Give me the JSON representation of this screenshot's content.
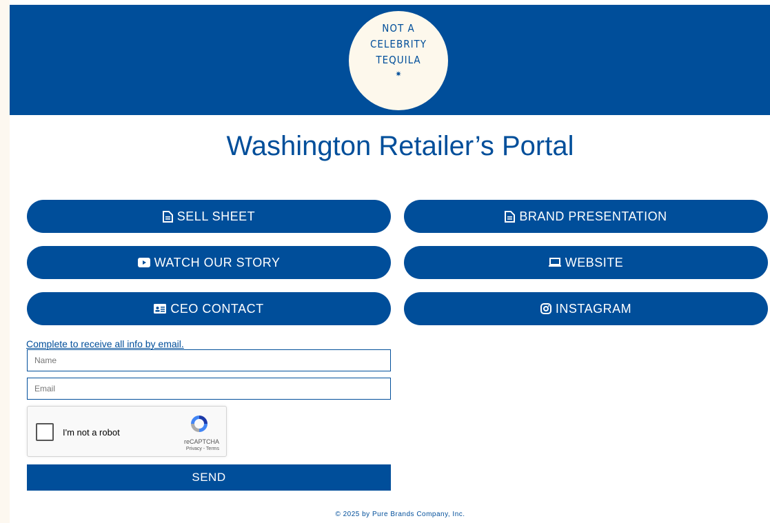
{
  "brand": {
    "logo_lines": [
      "NOT A",
      "CELEBRITY",
      "TEQUILA"
    ],
    "logo_mark_icon": "agave-icon"
  },
  "page": {
    "title": "Washington Retailer’s Portal"
  },
  "buttons": {
    "sell_sheet": {
      "label": "SELL SHEET",
      "icon": "document-icon"
    },
    "brand_presentation": {
      "label": "BRAND PRESENTATION",
      "icon": "document-icon"
    },
    "watch_story": {
      "label": "WATCH OUR STORY",
      "icon": "youtube-icon"
    },
    "website": {
      "label": "WEBSITE",
      "icon": "laptop-icon"
    },
    "ceo_contact": {
      "label": "CEO CONTACT",
      "icon": "id-card-icon"
    },
    "instagram": {
      "label": "INSTAGRAM",
      "icon": "instagram-icon"
    }
  },
  "form": {
    "intro": "Complete to receive all info by email.",
    "name_placeholder": "Name",
    "email_placeholder": "Email",
    "send_label": "SEND"
  },
  "captcha": {
    "label": "I'm not a robot",
    "brand": "reCAPTCHA",
    "terms": "Privacy - Terms"
  },
  "footer": {
    "text": "© 2025 by Pure Brands Company, Inc."
  },
  "colors": {
    "primary": "#004e9a",
    "logo_bg": "#fdf8ec",
    "page_bg": "#ffffff"
  }
}
